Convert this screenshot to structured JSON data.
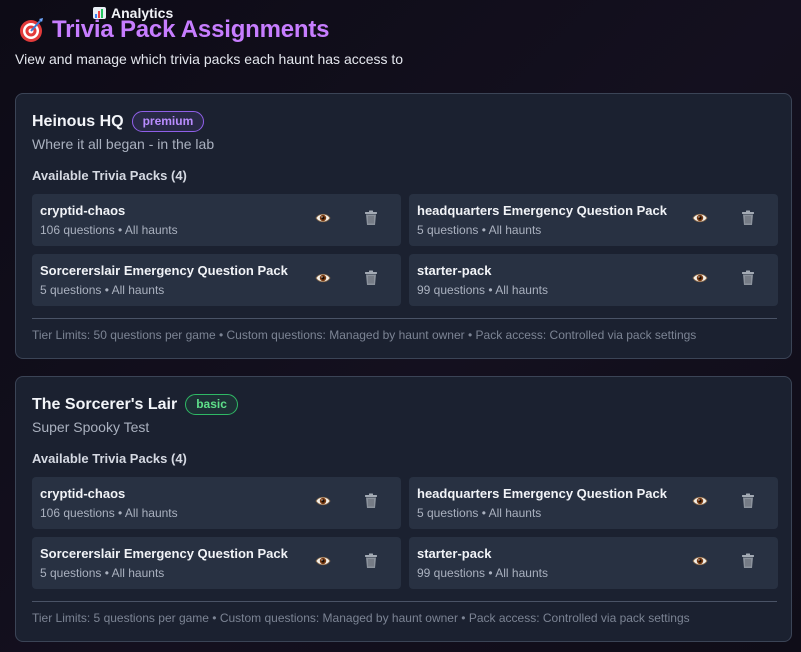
{
  "nav": {
    "analytics_label": "Analytics"
  },
  "header": {
    "title": "Trivia Pack Assignments",
    "subtitle": "View and manage which trivia packs each haunt has access to"
  },
  "haunts": [
    {
      "name": "Heinous HQ",
      "tier": "premium",
      "description": "Where it all began - in the lab",
      "packs_heading": "Available Trivia Packs (4)",
      "packs": [
        {
          "name": "cryptid-chaos",
          "meta": "106 questions • All haunts"
        },
        {
          "name": "headquarters Emergency Question Pack",
          "meta": "5 questions • All haunts"
        },
        {
          "name": "Sorcererslair Emergency Question Pack",
          "meta": "5 questions • All haunts"
        },
        {
          "name": "starter-pack",
          "meta": "99 questions • All haunts"
        }
      ],
      "limits": "Tier Limits: 50 questions per game • Custom questions: Managed by haunt owner • Pack access: Controlled via pack settings"
    },
    {
      "name": "The Sorcerer's Lair",
      "tier": "basic",
      "description": "Super Spooky Test",
      "packs_heading": "Available Trivia Packs (4)",
      "packs": [
        {
          "name": "cryptid-chaos",
          "meta": "106 questions • All haunts"
        },
        {
          "name": "headquarters Emergency Question Pack",
          "meta": "5 questions • All haunts"
        },
        {
          "name": "Sorcererslair Emergency Question Pack",
          "meta": "5 questions • All haunts"
        },
        {
          "name": "starter-pack",
          "meta": "99 questions • All haunts"
        }
      ],
      "limits": "Tier Limits: 5 questions per game • Custom questions: Managed by haunt owner • Pack access: Controlled via pack settings"
    }
  ],
  "icons": {
    "analytics": "bar-chart-icon",
    "title": "target-icon",
    "view": "eye-icon",
    "delete": "trash-icon"
  },
  "colors": {
    "title_accent": "#c77dff",
    "premium_badge": "#b98cff",
    "basic_badge": "#5ee08a",
    "card_bg": "#1b2130",
    "pack_bg": "#283142"
  }
}
